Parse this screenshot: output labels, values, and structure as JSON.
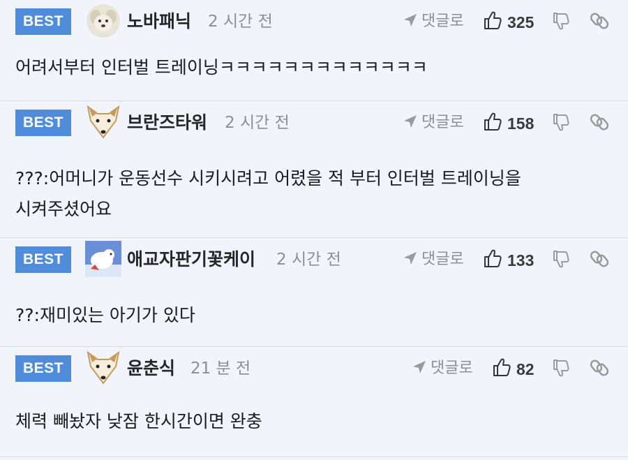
{
  "comments": [
    {
      "badge": "BEST",
      "username": "노바패닉",
      "timestamp": "2 시간 전",
      "reply_label": "댓글로",
      "likes": "325",
      "text": "어려서부터 인터벌 트레이닝ㅋㅋㅋㅋㅋㅋㅋㅋㅋㅋㅋㅋㅋ",
      "avatar": "puppy-avatar"
    },
    {
      "badge": "BEST",
      "username": "브란즈타워",
      "timestamp": "2 시간 전",
      "reply_label": "댓글로",
      "likes": "158",
      "text": "???:어머니가 운동선수 시키시려고 어렸을 적 부터 인터벌 트레이닝을 시켜주셨어요",
      "avatar": "fox-avatar"
    },
    {
      "badge": "BEST",
      "username": "애교자판기꽃케이",
      "timestamp": "2 시간 전",
      "reply_label": "댓글로",
      "likes": "133",
      "text": "??:재미있는 아기가 있다",
      "avatar": "polar-bear-avatar"
    },
    {
      "badge": "BEST",
      "username": "윤춘식",
      "timestamp": "21 분 전",
      "reply_label": "댓글로",
      "likes": "82",
      "text": "체력 빼놨자 낮잠 한시간이면 완충",
      "avatar": "fox-avatar"
    }
  ],
  "colors": {
    "background": "#f1f5fb",
    "best_badge": "#4f8cdb",
    "divider": "#d6dbe3",
    "muted_text": "#8e8e8e"
  }
}
